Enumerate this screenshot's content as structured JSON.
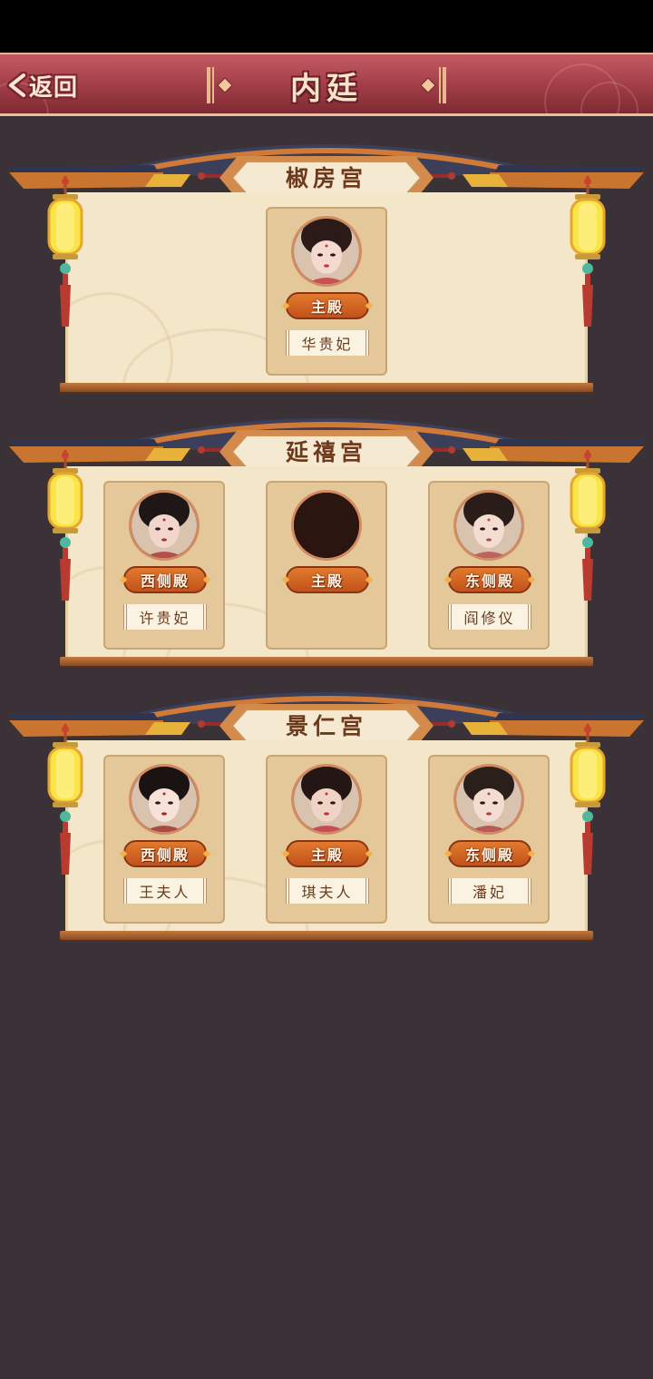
{
  "header": {
    "back_label": "返回",
    "title": "内廷"
  },
  "colors": {
    "header_red": "#9c3a44",
    "badge_orange": "#d8662a",
    "panel_cream": "#f4e6c8",
    "background": "#3a3236"
  },
  "palaces": [
    {
      "name": "椒房宫",
      "slots": [
        {
          "hall": "主殿",
          "consort": "华贵妃",
          "avatar": "consort-portrait-1"
        }
      ]
    },
    {
      "name": "延禧宫",
      "slots": [
        {
          "hall": "西侧殿",
          "consort": "许贵妃",
          "avatar": "consort-portrait-2"
        },
        {
          "hall": "主殿",
          "consort": "",
          "avatar": "empty-portrait"
        },
        {
          "hall": "东侧殿",
          "consort": "阎修仪",
          "avatar": "consort-portrait-3"
        }
      ]
    },
    {
      "name": "景仁宫",
      "slots": [
        {
          "hall": "西侧殿",
          "consort": "王夫人",
          "avatar": "consort-portrait-4"
        },
        {
          "hall": "主殿",
          "consort": "琪夫人",
          "avatar": "consort-portrait-5"
        },
        {
          "hall": "东侧殿",
          "consort": "潘妃",
          "avatar": "consort-portrait-6"
        }
      ]
    }
  ]
}
